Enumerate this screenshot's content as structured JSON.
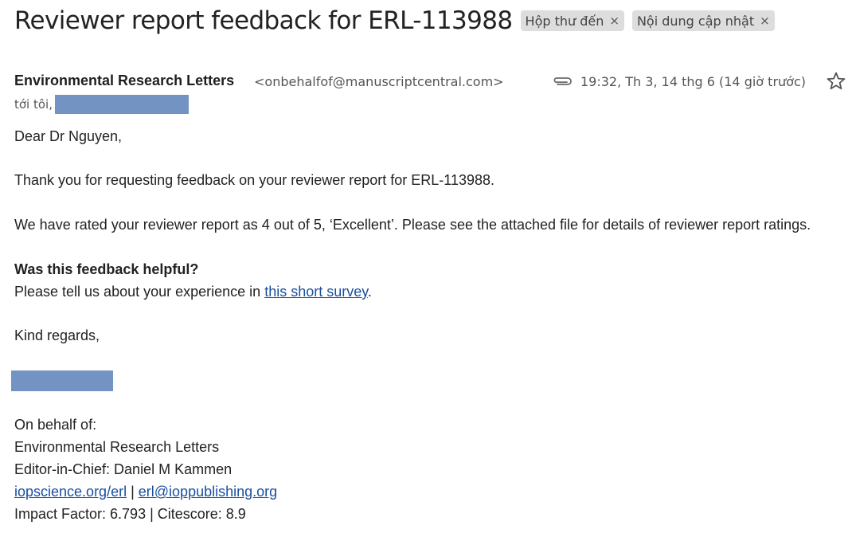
{
  "header": {
    "subject": "Reviewer report feedback for ERL-113988",
    "labels": [
      {
        "text": "Hộp thư đến",
        "close": "×"
      },
      {
        "text": "Nội dung cập nhật",
        "close": "×"
      }
    ]
  },
  "message": {
    "sender_name": "Environmental Research Letters",
    "sender_email": "<onbehalfof@manuscriptcentral.com>",
    "date": "19:32, Th 3, 14 thg 6 (14 giờ trước)",
    "to_label": "tới tôi,",
    "icons": {
      "attachment": "paperclip-icon",
      "star": "star-icon"
    }
  },
  "body": {
    "greeting": "Dear Dr Nguyen,",
    "para1": "Thank you for requesting feedback on your reviewer report for ERL-113988.",
    "para2": "We have rated your reviewer report as 4 out of 5, ‘Excellent’. Please see the attached file for details of reviewer report ratings.",
    "question": "Was this feedback helpful?",
    "survey_prefix": "Please tell us about your experience in ",
    "survey_link": "this short survey",
    "survey_suffix": ".",
    "closing": "Kind regards,"
  },
  "signature": {
    "on_behalf": "On behalf of:",
    "journal": "Environmental Research Letters",
    "editor": "Editor-in-Chief: Daniel M Kammen",
    "link1": "iopscience.org/erl",
    "separator": " | ",
    "link2": "erl@ioppublishing.org",
    "metrics": "Impact Factor: 6.793 | Citescore: 8.9"
  },
  "colors": {
    "link": "#1a4fa0",
    "redaction": "#7393c3",
    "chip_bg": "#dddddd"
  }
}
